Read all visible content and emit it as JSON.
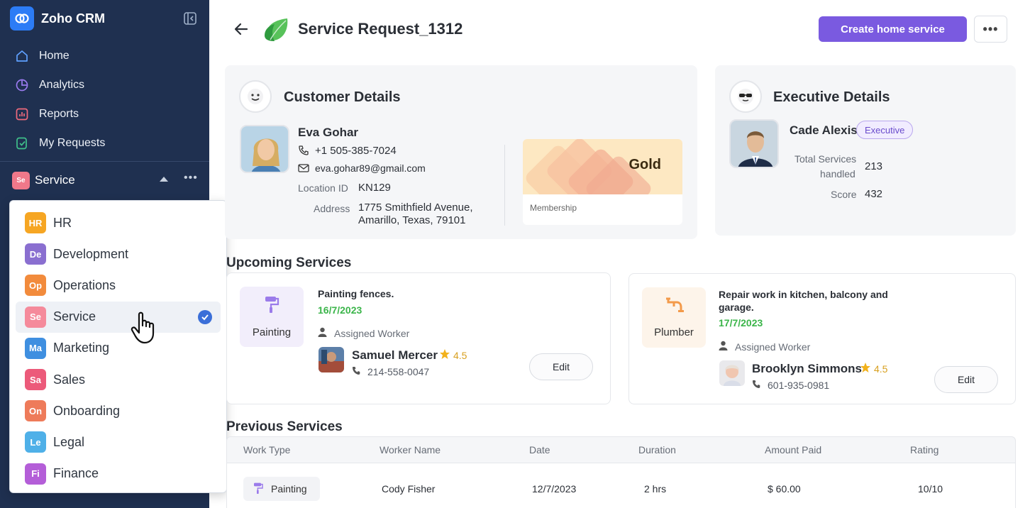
{
  "app": {
    "name": "Zoho CRM"
  },
  "sidebar": {
    "nav": [
      {
        "label": "Home",
        "icon": "home-icon"
      },
      {
        "label": "Analytics",
        "icon": "analytics-icon"
      },
      {
        "label": "Reports",
        "icon": "reports-icon"
      },
      {
        "label": "My Requests",
        "icon": "requests-icon"
      }
    ],
    "module": {
      "badge": "Se",
      "label": "Service"
    }
  },
  "dropdown": {
    "items": [
      {
        "badge": "HR",
        "label": "HR",
        "color": "#f6a623"
      },
      {
        "badge": "De",
        "label": "Development",
        "color": "#8a6fd0"
      },
      {
        "badge": "Op",
        "label": "Operations",
        "color": "#f28b3c"
      },
      {
        "badge": "Se",
        "label": "Service",
        "color": "#f58a9b",
        "selected": true
      },
      {
        "badge": "Ma",
        "label": "Marketing",
        "color": "#3f8fe0"
      },
      {
        "badge": "Sa",
        "label": "Sales",
        "color": "#ec5a7a"
      },
      {
        "badge": "On",
        "label": "Onboarding",
        "color": "#ee7b5a"
      },
      {
        "badge": "Le",
        "label": "Legal",
        "color": "#4fb0e8"
      },
      {
        "badge": "Fi",
        "label": "Finance",
        "color": "#b45ed8"
      }
    ]
  },
  "header": {
    "title": "Service Request_1312",
    "create_button": "Create home service",
    "more_button": "•••"
  },
  "customer": {
    "section_title": "Customer Details",
    "name": "Eva Gohar",
    "phone": "+1 505-385-7024",
    "email": "eva.gohar89@gmail.com",
    "location_label": "Location ID",
    "location_id": "KN129",
    "address_label": "Address",
    "address_line1": "1775 Smithfield Avenue,",
    "address_line2": "Amarillo, Texas, 79101",
    "membership_tier": "Gold",
    "membership_label": "Membership"
  },
  "executive": {
    "section_title": "Executive Details",
    "name": "Cade Alexis",
    "badge": "Executive",
    "services_label_1": "Total Services",
    "services_label_2": "handled",
    "services_value": "213",
    "score_label": "Score",
    "score_value": "432"
  },
  "upcoming": {
    "heading": "Upcoming Services",
    "services": [
      {
        "type": "Painting",
        "title_line1": "Painting fences.",
        "title_line2": "",
        "date": "16/7/2023",
        "assigned_label": "Assigned Worker",
        "worker": "Samuel Mercer",
        "rating": "4.5",
        "phone": "214-558-0047",
        "edit": "Edit"
      },
      {
        "type": "Plumber",
        "title_line1": "Repair work in kitchen, balcony and",
        "title_line2": "garage.",
        "date": "17/7/2023",
        "assigned_label": "Assigned Worker",
        "worker": "Brooklyn Simmons",
        "rating": "4.5",
        "phone": "601-935-0981",
        "edit": "Edit"
      }
    ]
  },
  "previous": {
    "heading": "Previous Services",
    "columns": [
      "Work Type",
      "Worker Name",
      "Date",
      "Duration",
      "Amount Paid",
      "Rating"
    ],
    "rows": [
      {
        "work_type": "Painting",
        "worker": "Cody Fisher",
        "date": "12/7/2023",
        "duration": "2 hrs",
        "amount": "$ 60.00",
        "rating": "10/10"
      }
    ]
  },
  "colors": {
    "sidebar_bg": "#1f3050",
    "accent": "#7a5ae0",
    "date_green": "#3bb54a",
    "star": "#f2b21c"
  }
}
